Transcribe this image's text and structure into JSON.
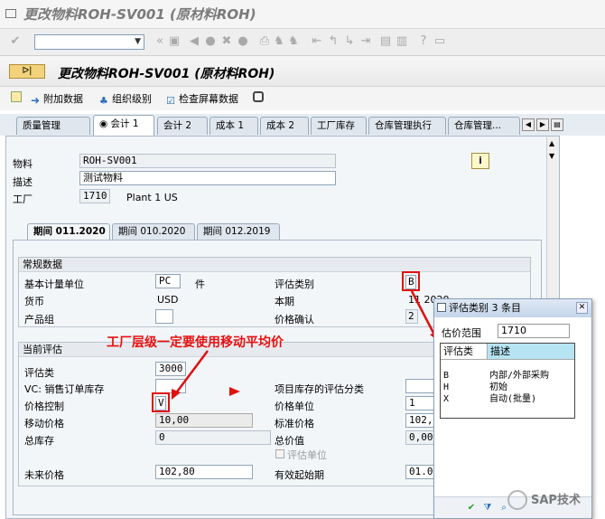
{
  "window": {
    "title": "更改物料ROH-SV001 (原材料ROH)"
  },
  "screen": {
    "title": "更改物料ROH-SV001 (原材料ROH)",
    "button_label": "ᐅ|"
  },
  "toolbar": {
    "items": [
      {
        "label": "附加数据"
      },
      {
        "label": "组织级别"
      },
      {
        "label": "检查屏幕数据"
      }
    ]
  },
  "tabs": [
    {
      "label": "质量管理"
    },
    {
      "label": "会计 1",
      "active": true
    },
    {
      "label": "会计 2"
    },
    {
      "label": "成本 1"
    },
    {
      "label": "成本 2"
    },
    {
      "label": "工厂库存"
    },
    {
      "label": "仓库管理执行"
    },
    {
      "label": "仓库管理..."
    }
  ],
  "header": {
    "material_label": "物料",
    "material_value": "ROH-SV001",
    "desc_label": "描述",
    "desc_value": "测试物料",
    "plant_label": "工厂",
    "plant_value": "1710",
    "plant_name": "Plant 1 US",
    "info_icon": "i"
  },
  "period_tabs": [
    {
      "label": "期间 011.2020",
      "active": true
    },
    {
      "label": "期间 010.2020"
    },
    {
      "label": "期间 012.2019"
    }
  ],
  "general": {
    "title": "常规数据",
    "base_uom_label": "基本计量单位",
    "base_uom_value": "PC",
    "base_uom_text": "件",
    "currency_label": "货币",
    "currency_value": "USD",
    "product_group_label": "产品组",
    "product_group_value": "",
    "valuation_cat_label": "评估类别",
    "valuation_cat_value": "B",
    "current_period_label": "本期",
    "current_period_value": "11 2020",
    "price_determ_label": "价格确认",
    "price_determ_value": "2"
  },
  "current": {
    "title": "当前评估",
    "valclass_label": "评估类",
    "valclass_value": "3000",
    "vc_label": "VC: 销售订单库存",
    "vc_value": "",
    "price_ctrl_label": "价格控制",
    "price_ctrl_value": "V",
    "mov_price_label": "移动价格",
    "mov_price_value": "10,00",
    "total_stock_label": "总库存",
    "total_stock_value": "0",
    "future_price_label": "未来价格",
    "future_price_value": "102,80",
    "proj_stock_label": "项目库存的评估分类",
    "proj_stock_value": "",
    "price_unit_label": "价格单位",
    "price_unit_value": "1",
    "std_price_label": "标准价格",
    "std_price_value": "102,",
    "total_value_label": "总价值",
    "total_value_value": "0,00",
    "val_unit_label": "评估单位",
    "valid_from_label": "有效起始期",
    "valid_from_value": "01.0"
  },
  "annotation": {
    "text": "工厂层级一定要使用移动平均价"
  },
  "popup": {
    "title": "评估类别 3 条目",
    "area_label": "估价范围",
    "area_value": "1710",
    "col1": "评估类",
    "col2": "描述",
    "rows": [
      {
        "key": "B",
        "desc": "内部/外部采购"
      },
      {
        "key": "H",
        "desc": "初始"
      },
      {
        "key": "X",
        "desc": "自动(批量)"
      }
    ]
  },
  "watermark": {
    "text": "SAP技术"
  },
  "colors": {
    "red": "#e01010",
    "accent": "#f2d27a"
  }
}
